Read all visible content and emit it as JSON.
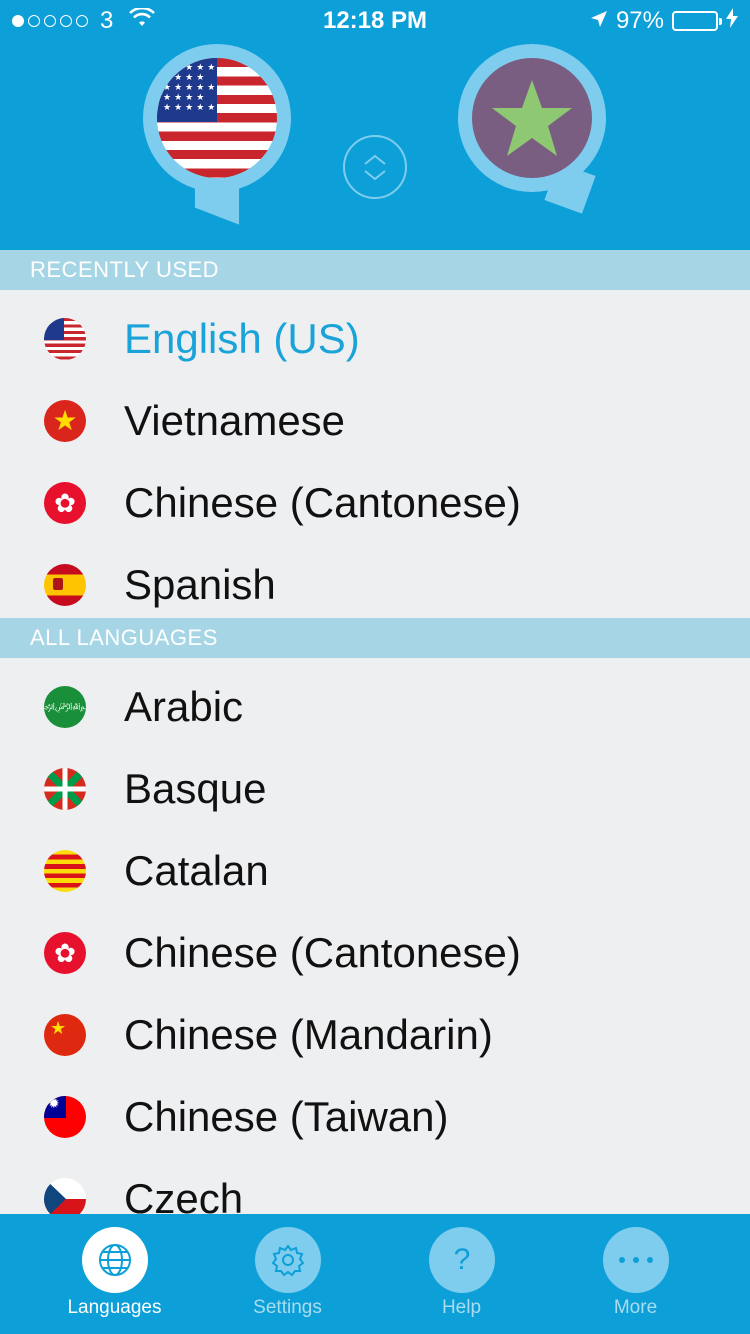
{
  "status_bar": {
    "carrier": "3",
    "time": "12:18 PM",
    "battery_percent": "97%",
    "battery_level": 0.97
  },
  "header": {
    "from_language_icon": "us-flag",
    "to_language_icon": "star-placeholder",
    "swap_icon": "swap-vertical-icon"
  },
  "sections": {
    "recent_title": "RECENTLY USED",
    "all_title": "ALL LANGUAGES"
  },
  "recent_languages": [
    {
      "label": "English (US)",
      "flag": "us",
      "selected": true
    },
    {
      "label": "Vietnamese",
      "flag": "vn"
    },
    {
      "label": "Chinese (Cantonese)",
      "flag": "hk"
    },
    {
      "label": "Spanish",
      "flag": "es"
    }
  ],
  "all_languages": [
    {
      "label": "Arabic",
      "flag": "sa"
    },
    {
      "label": "Basque",
      "flag": "eu"
    },
    {
      "label": "Catalan",
      "flag": "ca"
    },
    {
      "label": "Chinese (Cantonese)",
      "flag": "hk"
    },
    {
      "label": "Chinese (Mandarin)",
      "flag": "cn"
    },
    {
      "label": "Chinese (Taiwan)",
      "flag": "tw"
    },
    {
      "label": "Czech",
      "flag": "cz"
    }
  ],
  "tabs": [
    {
      "label": "Languages",
      "icon": "globe-icon",
      "active": true
    },
    {
      "label": "Settings",
      "icon": "gear-icon"
    },
    {
      "label": "Help",
      "icon": "question-icon"
    },
    {
      "label": "More",
      "icon": "ellipsis-icon"
    }
  ],
  "colors": {
    "brand": "#0d9fd8",
    "bubble": "#7fcdee",
    "section_header": "#a6d6e6",
    "selected_text": "#1aa3d9"
  }
}
